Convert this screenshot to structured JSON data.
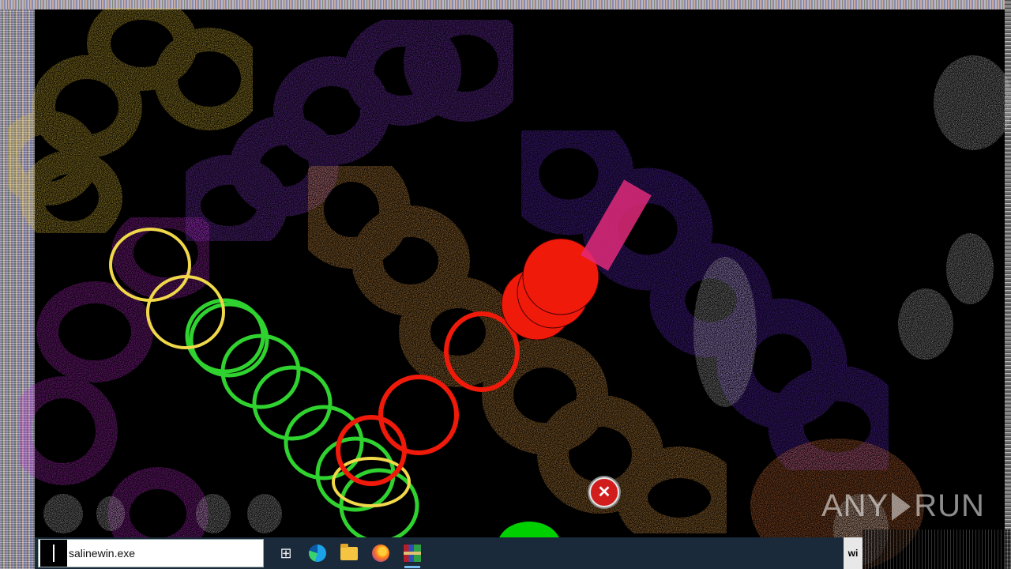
{
  "desktop": {
    "description_colors": {
      "yellow": "#e8c53a",
      "purple": "#7a2fd6",
      "magenta": "#c02bd0",
      "orange": "#e9a24a",
      "green": "#2fd22f",
      "red": "#f01a0a",
      "gray": "#b9b9b9"
    }
  },
  "error_popup": {
    "icon": "error-x-icon",
    "glyph": "✕"
  },
  "watermark": {
    "left": "ANY",
    "right": "RUN"
  },
  "taskbar": {
    "search_value": "salinewin.exe",
    "icons": [
      "task-view-icon",
      "edge-icon",
      "file-explorer-icon",
      "firefox-icon",
      "archive-app-icon"
    ],
    "tray_text": "wi"
  }
}
